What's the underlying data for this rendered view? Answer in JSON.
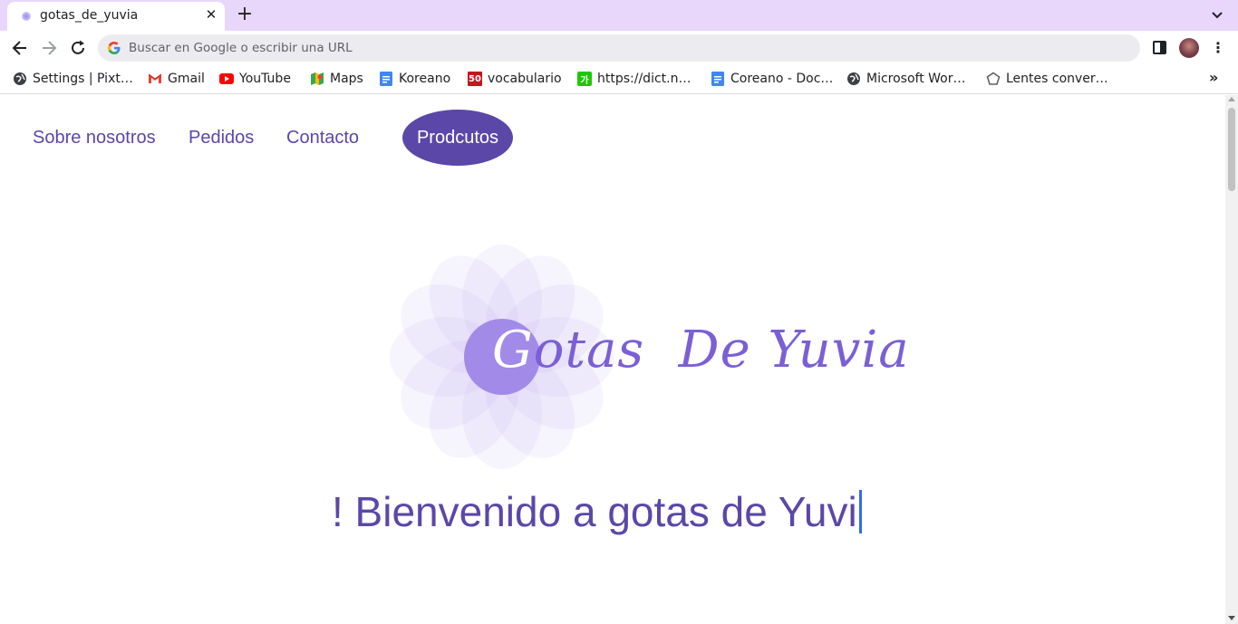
{
  "browser": {
    "tab": {
      "title": "gotas_de_yuvia",
      "close_icon": "✕",
      "favicon": "gotas-favicon"
    },
    "new_tab_label": "+",
    "omnibox": {
      "placeholder": "Buscar en Google o escribir una URL"
    },
    "bookmarks": [
      {
        "label": "Settings | Pixt…",
        "icon": "globe-icon"
      },
      {
        "label": "Gmail",
        "icon": "gmail-icon"
      },
      {
        "label": "YouTube",
        "icon": "youtube-icon"
      },
      {
        "label": "Maps",
        "icon": "maps-icon"
      },
      {
        "label": "Koreano",
        "icon": "docs-icon"
      },
      {
        "label": "vocabulario",
        "icon": "fifty-icon",
        "icon_text": "50"
      },
      {
        "label": "https://dict.n…",
        "icon": "naver-dict-icon",
        "icon_text": "가"
      },
      {
        "label": "Coreano - Doc…",
        "icon": "docs-icon"
      },
      {
        "label": "Microsoft Wor…",
        "icon": "globe-icon"
      },
      {
        "label": "Lentes conver…",
        "icon": "pentagon-icon"
      }
    ],
    "bookmarks_more": "»"
  },
  "page": {
    "nav": {
      "links": [
        "Sobre nosotros",
        "Pedidos",
        "Contacto"
      ],
      "active_button": "Prodcutos"
    },
    "logo": {
      "g": "G",
      "rest": "otas  De Yuvia"
    },
    "welcome_text": "! Bienvenido a gotas de Yuvi"
  },
  "colors": {
    "tabstrip": "#e9d7fb",
    "brand_purple": "#5b47a8",
    "logo_purple": "#7b5fd6",
    "caret": "#2f6fe4"
  }
}
